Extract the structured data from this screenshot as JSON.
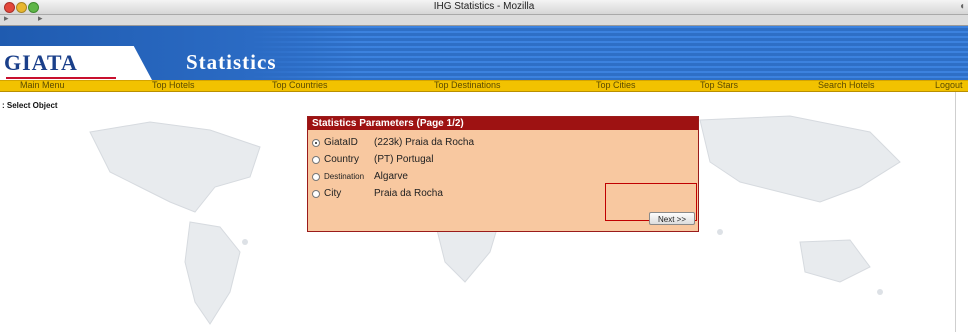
{
  "window": {
    "title": "IHG Statistics - Mozilla"
  },
  "banner": {
    "logo_text": "GIATA",
    "title": "Statistics"
  },
  "nav": {
    "items": [
      {
        "label": "Main Menu"
      },
      {
        "label": "Top Hotels"
      },
      {
        "label": "Top Countries"
      },
      {
        "label": "Top Destinations"
      },
      {
        "label": "Top Cities"
      },
      {
        "label": "Top Stars"
      },
      {
        "label": "Search Hotels"
      },
      {
        "label": "Logout"
      }
    ]
  },
  "page": {
    "select_object_label": "Select Object"
  },
  "dialog": {
    "title": "Statistics Parameters (Page 1/2)",
    "options": [
      {
        "label": "GiataID",
        "value": "(223k) Praia da Rocha",
        "checked": true
      },
      {
        "label": "Country",
        "value": "(PT) Portugal",
        "checked": false
      },
      {
        "label": "Destination",
        "value": "Algarve",
        "checked": false
      },
      {
        "label": "City",
        "value": "Praia da Rocha",
        "checked": false
      }
    ],
    "next_button": "Next >>"
  },
  "colors": {
    "banner_blue": "#2e6fc6",
    "nav_yellow": "#f2c200",
    "dialog_header": "#9e1212",
    "dialog_bg": "#f8c8a0"
  }
}
